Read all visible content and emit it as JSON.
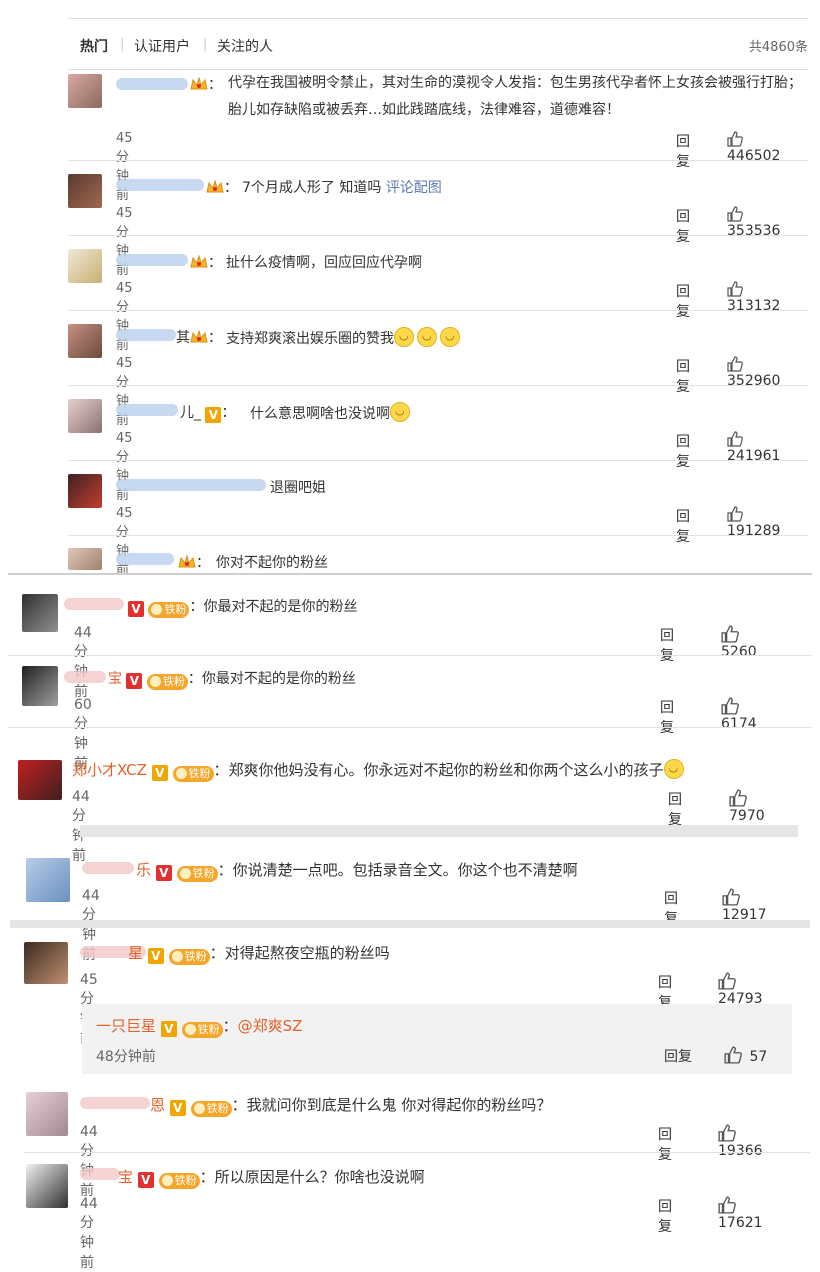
{
  "tabs": {
    "hot": "热门",
    "verified": "认证用户",
    "following": "关注的人",
    "sep": "|",
    "total": "共4860条"
  },
  "ui": {
    "reply": "回复",
    "colon": "：",
    "crown_icon": "crown-icon",
    "thumb_icon": "thumbs-up-icon",
    "smile_icon": "smile-emoji-icon",
    "fan_label": "铁粉"
  },
  "comments": [
    {
      "name_visible": "",
      "text": "代孕在我国被明令禁止，其对生命的漠视令人发指：包生男孩代孕者怀上女孩会被强行打胎；胎儿如存缺陷或被丢弃…如此践踏底线，法律难容，道德难容！",
      "time": "45分钟前",
      "likes": "446502"
    },
    {
      "name_visible": "",
      "text": "7个月成人形了 知道吗",
      "link": "评论配图",
      "time": "45分钟前",
      "likes": "353536"
    },
    {
      "name_visible": "",
      "text": "扯什么疫情啊，回应回应代孕啊",
      "time": "45分钟前",
      "likes": "313132"
    },
    {
      "name_visible": "其",
      "text": "支持郑爽滚出娱乐圈的赞我",
      "time": "45分钟前",
      "likes": "352960"
    },
    {
      "name_visible": "儿_",
      "text": "什么意思啊啥也没说啊",
      "time": "45分钟前",
      "likes": "241961"
    },
    {
      "name_visible": "",
      "text": "退圈吧姐",
      "time": "45分钟前",
      "likes": "191289"
    },
    {
      "name_visible": "",
      "text": "你对不起你的粉丝"
    },
    {
      "name_visible": "",
      "text": "你最对不起的是你的粉丝",
      "time": "44分钟前",
      "likes": "5260"
    },
    {
      "name_visible": "宝",
      "text": "你最对不起的是你的粉丝",
      "time": "60分钟前",
      "likes": "6174"
    },
    {
      "name_visible": "郑小才XCZ",
      "text": "郑爽你他妈没有心。你永远对不起你的粉丝和你两个这么小的孩子",
      "time": "44分钟前",
      "likes": "7970"
    },
    {
      "name_visible": "乐",
      "text": "你说清楚一点吧。包括录音全文。你这个也不清楚啊",
      "time": "44分钟前",
      "likes": "12917"
    },
    {
      "name_visible": "星",
      "text": "对得起熬夜空瓶的粉丝吗",
      "time": "45分钟前",
      "likes": "24793"
    },
    {
      "name_visible": "一只巨星",
      "text": "@郑爽SZ",
      "time": "48分钟前",
      "likes": "57"
    },
    {
      "name_visible": "恩",
      "text": "我就问你到底是什么鬼 你对得起你的粉丝吗？",
      "time": "44分钟前",
      "likes": "19366"
    },
    {
      "name_visible": "宝",
      "text": "所以原因是什么？你啥也没说啊",
      "time": "44分钟前",
      "likes": "17621"
    }
  ]
}
